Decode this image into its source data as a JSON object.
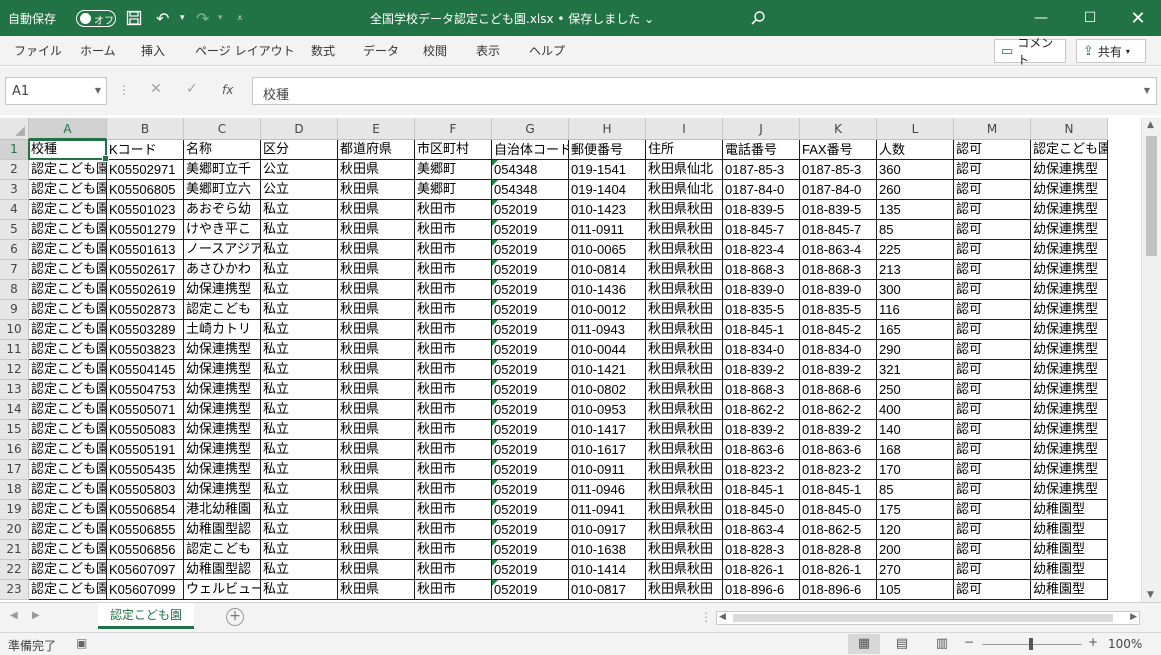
{
  "titlebar": {
    "autosave_label": "自動保存",
    "autosave_state": "オフ",
    "document_title": "全国学校データ認定こども園.xlsx • 保存しました ⌄",
    "accent_color": "#217346"
  },
  "ribbon": {
    "tabs": [
      "ファイル",
      "ホーム",
      "挿入",
      "ページ レイアウト",
      "数式",
      "データ",
      "校閲",
      "表示",
      "ヘルプ"
    ],
    "comment_label": "コメント",
    "share_label": "共有"
  },
  "formula_bar": {
    "name_box": "A1",
    "content": "校種"
  },
  "grid": {
    "columns": [
      "A",
      "B",
      "C",
      "D",
      "E",
      "F",
      "G",
      "H",
      "I",
      "J",
      "K",
      "L",
      "M",
      "N"
    ],
    "row_numbers": [
      "1",
      "2",
      "3",
      "4",
      "5",
      "6",
      "7",
      "8",
      "9",
      "10",
      "11",
      "12",
      "13",
      "14",
      "15",
      "16",
      "17",
      "18",
      "19",
      "20",
      "21",
      "22",
      "23"
    ],
    "rows": [
      [
        "校種",
        "Kコード",
        "名称",
        "区分",
        "都道府県",
        "市区町村",
        "自治体コード",
        "郵便番号",
        "住所",
        "電話番号",
        "FAX番号",
        "人数",
        "認可",
        "認定こども園類型"
      ],
      [
        "認定こども園",
        "K05502971",
        "美郷町立千",
        "公立",
        "秋田県",
        "美郷町",
        "054348",
        "019-1541",
        "秋田県仙北",
        "0187-85-3",
        "0187-85-3",
        "360",
        "認可",
        "幼保連携型"
      ],
      [
        "認定こども園",
        "K05506805",
        "美郷町立六",
        "公立",
        "秋田県",
        "美郷町",
        "054348",
        "019-1404",
        "秋田県仙北",
        "0187-84-0",
        "0187-84-0",
        "260",
        "認可",
        "幼保連携型"
      ],
      [
        "認定こども園",
        "K05501023",
        "あおぞら幼",
        "私立",
        "秋田県",
        "秋田市",
        "052019",
        "010-1423",
        "秋田県秋田",
        "018-839-5",
        "018-839-5",
        "135",
        "認可",
        "幼保連携型"
      ],
      [
        "認定こども園",
        "K05501279",
        "けやき平こ",
        "私立",
        "秋田県",
        "秋田市",
        "052019",
        "011-0911",
        "秋田県秋田",
        "018-845-7",
        "018-845-7",
        "85",
        "認可",
        "幼保連携型"
      ],
      [
        "認定こども園",
        "K05501613",
        "ノースアジア",
        "私立",
        "秋田県",
        "秋田市",
        "052019",
        "010-0065",
        "秋田県秋田",
        "018-823-4",
        "018-863-4",
        "225",
        "認可",
        "幼保連携型"
      ],
      [
        "認定こども園",
        "K05502617",
        "あさひかわ",
        "私立",
        "秋田県",
        "秋田市",
        "052019",
        "010-0814",
        "秋田県秋田",
        "018-868-3",
        "018-868-3",
        "213",
        "認可",
        "幼保連携型"
      ],
      [
        "認定こども園",
        "K05502619",
        "幼保連携型",
        "私立",
        "秋田県",
        "秋田市",
        "052019",
        "010-1436",
        "秋田県秋田",
        "018-839-0",
        "018-839-0",
        "300",
        "認可",
        "幼保連携型"
      ],
      [
        "認定こども園",
        "K05502873",
        "認定こども",
        "私立",
        "秋田県",
        "秋田市",
        "052019",
        "010-0012",
        "秋田県秋田",
        "018-835-5",
        "018-835-5",
        "116",
        "認可",
        "幼保連携型"
      ],
      [
        "認定こども園",
        "K05503289",
        "土崎カトリ",
        "私立",
        "秋田県",
        "秋田市",
        "052019",
        "011-0943",
        "秋田県秋田",
        "018-845-1",
        "018-845-2",
        "165",
        "認可",
        "幼保連携型"
      ],
      [
        "認定こども園",
        "K05503823",
        "幼保連携型",
        "私立",
        "秋田県",
        "秋田市",
        "052019",
        "010-0044",
        "秋田県秋田",
        "018-834-0",
        "018-834-0",
        "290",
        "認可",
        "幼保連携型"
      ],
      [
        "認定こども園",
        "K05504145",
        "幼保連携型",
        "私立",
        "秋田県",
        "秋田市",
        "052019",
        "010-1421",
        "秋田県秋田",
        "018-839-2",
        "018-839-2",
        "321",
        "認可",
        "幼保連携型"
      ],
      [
        "認定こども園",
        "K05504753",
        "幼保連携型",
        "私立",
        "秋田県",
        "秋田市",
        "052019",
        "010-0802",
        "秋田県秋田",
        "018-868-3",
        "018-868-6",
        "250",
        "認可",
        "幼保連携型"
      ],
      [
        "認定こども園",
        "K05505071",
        "幼保連携型",
        "私立",
        "秋田県",
        "秋田市",
        "052019",
        "010-0953",
        "秋田県秋田",
        "018-862-2",
        "018-862-2",
        "400",
        "認可",
        "幼保連携型"
      ],
      [
        "認定こども園",
        "K05505083",
        "幼保連携型",
        "私立",
        "秋田県",
        "秋田市",
        "052019",
        "010-1417",
        "秋田県秋田",
        "018-839-2",
        "018-839-2",
        "140",
        "認可",
        "幼保連携型"
      ],
      [
        "認定こども園",
        "K05505191",
        "幼保連携型",
        "私立",
        "秋田県",
        "秋田市",
        "052019",
        "010-1617",
        "秋田県秋田",
        "018-863-6",
        "018-863-6",
        "168",
        "認可",
        "幼保連携型"
      ],
      [
        "認定こども園",
        "K05505435",
        "幼保連携型",
        "私立",
        "秋田県",
        "秋田市",
        "052019",
        "010-0911",
        "秋田県秋田",
        "018-823-2",
        "018-823-2",
        "170",
        "認可",
        "幼保連携型"
      ],
      [
        "認定こども園",
        "K05505803",
        "幼保連携型",
        "私立",
        "秋田県",
        "秋田市",
        "052019",
        "011-0946",
        "秋田県秋田",
        "018-845-1",
        "018-845-1",
        "85",
        "認可",
        "幼保連携型"
      ],
      [
        "認定こども園",
        "K05506854",
        "港北幼稚園",
        "私立",
        "秋田県",
        "秋田市",
        "052019",
        "011-0941",
        "秋田県秋田",
        "018-845-0",
        "018-845-0",
        "175",
        "認可",
        "幼稚園型"
      ],
      [
        "認定こども園",
        "K05506855",
        "幼稚園型認",
        "私立",
        "秋田県",
        "秋田市",
        "052019",
        "010-0917",
        "秋田県秋田",
        "018-863-4",
        "018-862-5",
        "120",
        "認可",
        "幼稚園型"
      ],
      [
        "認定こども園",
        "K05506856",
        "認定こども",
        "私立",
        "秋田県",
        "秋田市",
        "052019",
        "010-1638",
        "秋田県秋田",
        "018-828-3",
        "018-828-8",
        "200",
        "認可",
        "幼稚園型"
      ],
      [
        "認定こども園",
        "K05607097",
        "幼稚園型認",
        "私立",
        "秋田県",
        "秋田市",
        "052019",
        "010-1414",
        "秋田県秋田",
        "018-826-1",
        "018-826-1",
        "270",
        "認可",
        "幼稚園型"
      ],
      [
        "認定こども園",
        "K05607099",
        "ウェルビュー",
        "私立",
        "秋田県",
        "秋田市",
        "052019",
        "010-0817",
        "秋田県秋田",
        "018-896-6",
        "018-896-6",
        "105",
        "認可",
        "幼稚園型"
      ]
    ]
  },
  "sheet": {
    "tab_label": "認定こども園"
  },
  "status": {
    "ready_label": "準備完了",
    "zoom_label": "100%",
    "zoom_percent": 100
  }
}
